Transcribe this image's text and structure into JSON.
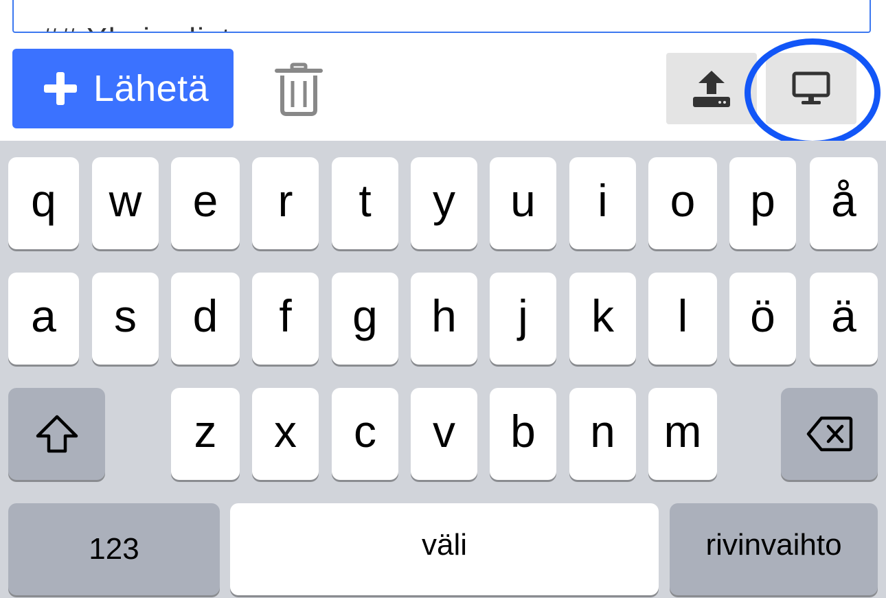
{
  "editor": {
    "text": "## Yhsin dist"
  },
  "toolbar": {
    "send_label": "Lähetä",
    "send_icon": "plus-icon",
    "delete_icon": "trash-icon",
    "upload_icon": "upload-icon",
    "desktop_icon": "desktop-icon",
    "accent_color": "#3b72ff",
    "highlight_color": "#1256f7"
  },
  "keyboard": {
    "row1": [
      "q",
      "w",
      "e",
      "r",
      "t",
      "y",
      "u",
      "i",
      "o",
      "p",
      "å"
    ],
    "row2": [
      "a",
      "s",
      "d",
      "f",
      "g",
      "h",
      "j",
      "k",
      "l",
      "ö",
      "ä"
    ],
    "row3": [
      "z",
      "x",
      "c",
      "v",
      "b",
      "n",
      "m"
    ],
    "shift_icon": "shift-icon",
    "backspace_icon": "backspace-icon",
    "numbers_label": "123",
    "space_label": "väli",
    "return_label": "rivinvaihto"
  }
}
